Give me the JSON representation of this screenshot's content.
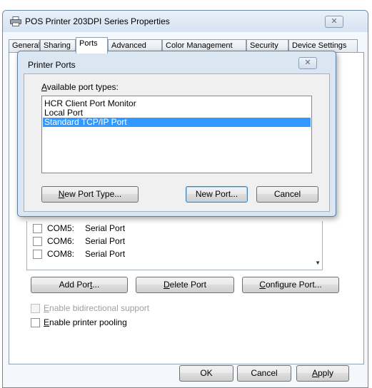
{
  "window": {
    "title": "POS Printer 203DPI  Series Properties",
    "close_glyph": "✕"
  },
  "tabs": [
    {
      "label": "General"
    },
    {
      "label": "Sharing"
    },
    {
      "label": "Ports"
    },
    {
      "label": "Advanced"
    },
    {
      "label": "Color Management"
    },
    {
      "label": "Security"
    },
    {
      "label": "Device Settings"
    }
  ],
  "ports": [
    {
      "name": "COM5:",
      "description": "Serial Port",
      "checked": false
    },
    {
      "name": "COM6:",
      "description": "Serial Port",
      "checked": false
    },
    {
      "name": "COM8:",
      "description": "Serial Port",
      "checked": false
    }
  ],
  "port_buttons": {
    "add_pre": "Add Por",
    "add_u": "t",
    "add_post": "...",
    "delete_u": "D",
    "delete_post": "elete Port",
    "configure_u": "C",
    "configure_post": "onfigure Port..."
  },
  "options": {
    "bidirectional_u": "E",
    "bidirectional_post": "nable bidirectional support",
    "bidirectional_checked": false,
    "bidirectional_enabled": false,
    "pooling_u": "E",
    "pooling_post": "nable printer pooling",
    "pooling_checked": false
  },
  "footer": {
    "ok": "OK",
    "cancel": "Cancel",
    "apply_u": "A",
    "apply_post": "pply"
  },
  "dialog": {
    "title": "Printer Ports",
    "list_label_u": "A",
    "list_label_post": "vailable port types:",
    "port_types": [
      {
        "label": "HCR Client Port Monitor",
        "selected": false
      },
      {
        "label": "Local Port",
        "selected": false
      },
      {
        "label": "Standard TCP/IP Port",
        "selected": true
      }
    ],
    "new_port_type_u": "N",
    "new_port_type_post": "ew Port Type...",
    "new_port": "New Port...",
    "cancel": "Cancel"
  },
  "colors": {
    "selection": "#3399ff",
    "dialog_frame": "#dbe6f3",
    "title_gradient_top": "#e9f1fa"
  }
}
